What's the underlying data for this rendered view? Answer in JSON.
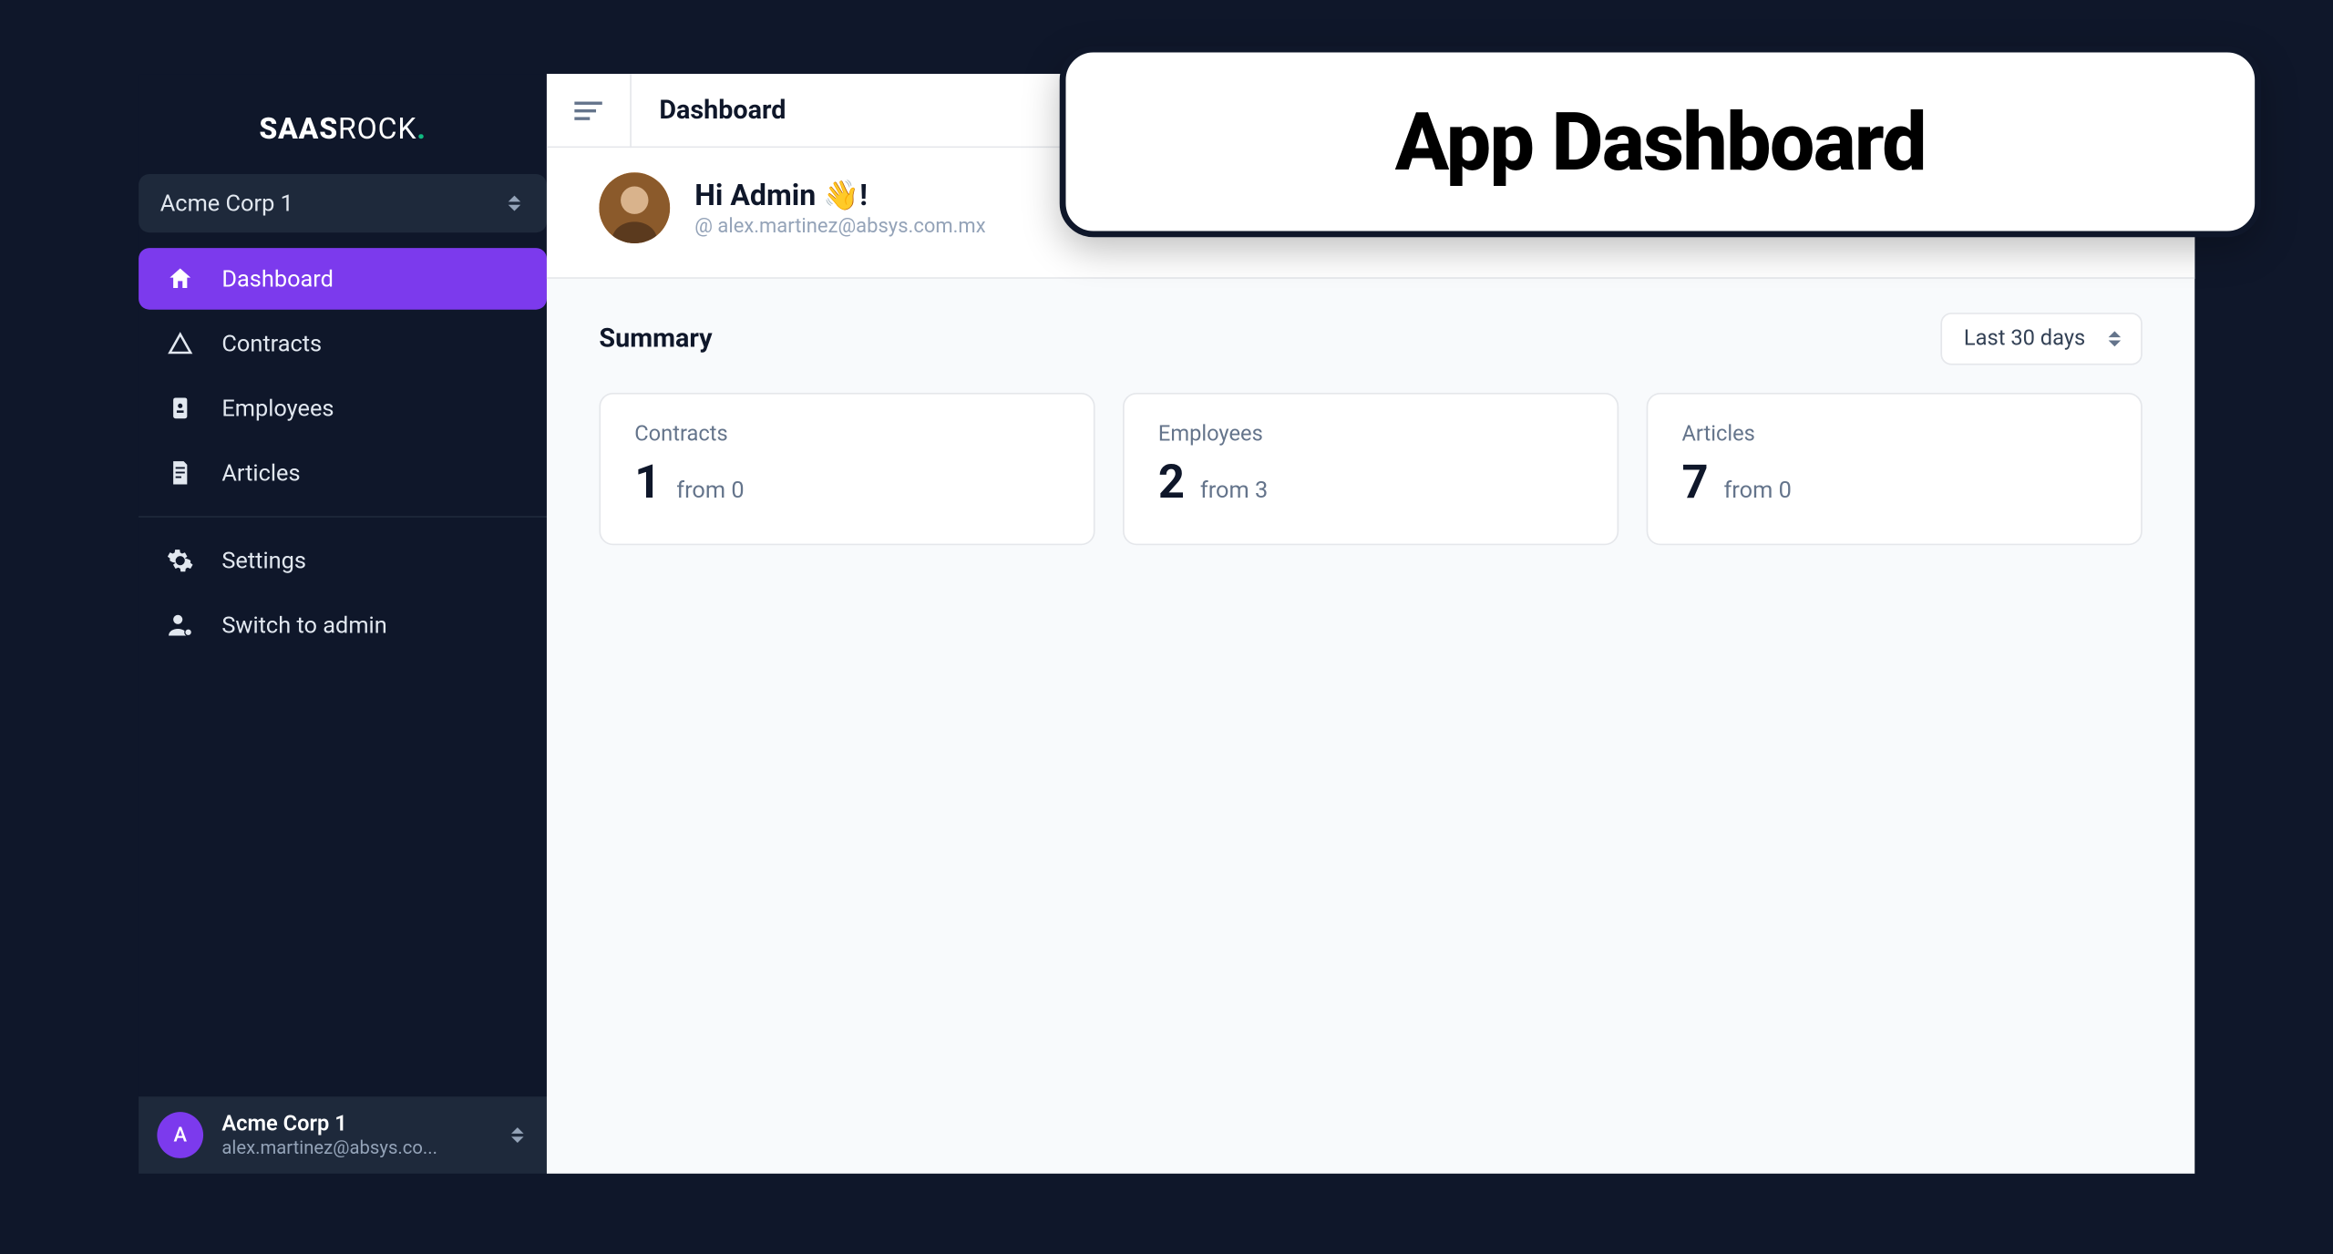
{
  "brand": {
    "a": "SAAS",
    "b": "ROCK",
    "dot": "."
  },
  "sidebar": {
    "org_selector": "Acme Corp 1",
    "items": [
      {
        "label": "Dashboard"
      },
      {
        "label": "Contracts"
      },
      {
        "label": "Employees"
      },
      {
        "label": "Articles"
      }
    ],
    "secondary": [
      {
        "label": "Settings"
      },
      {
        "label": "Switch to admin"
      }
    ],
    "footer": {
      "avatar_initial": "A",
      "title": "Acme Corp 1",
      "subtitle": "alex.martinez@absys.co..."
    }
  },
  "topbar": {
    "title": "Dashboard"
  },
  "greeting": {
    "title": "Hi Admin 👋!",
    "email_prefix": "@",
    "email": "alex.martinez@absys.com.mx"
  },
  "summary": {
    "title": "Summary",
    "period": "Last 30 days",
    "cards": [
      {
        "label": "Contracts",
        "value": "1",
        "from": "from 0"
      },
      {
        "label": "Employees",
        "value": "2",
        "from": "from 3"
      },
      {
        "label": "Articles",
        "value": "7",
        "from": "from 0"
      }
    ]
  },
  "overlay": {
    "title": "App Dashboard"
  }
}
